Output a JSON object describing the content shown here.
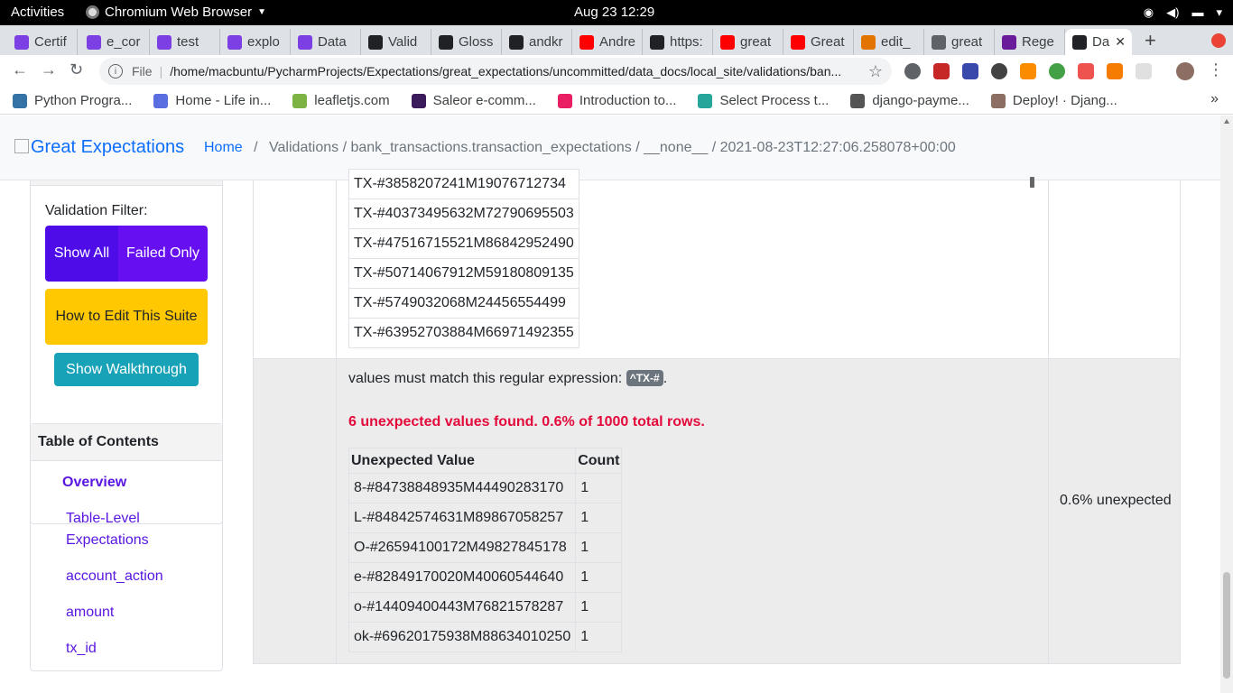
{
  "system_bar": {
    "activities": "Activities",
    "app_name": "Chromium Web Browser",
    "clock": "Aug 23  12:29"
  },
  "tabs": [
    {
      "label": "Certif",
      "icon_color": "#7b3fe4"
    },
    {
      "label": "e_cor",
      "icon_color": "#7b3fe4"
    },
    {
      "label": "test",
      "icon_color": "#7b3fe4"
    },
    {
      "label": "explo",
      "icon_color": "#7b3fe4"
    },
    {
      "label": "Data",
      "icon_color": "#7b3fe4"
    },
    {
      "label": "Valid",
      "icon_color": "#202124"
    },
    {
      "label": "Gloss",
      "icon_color": "#202124"
    },
    {
      "label": "andkr",
      "icon_color": "#202124"
    },
    {
      "label": "Andre",
      "icon_color": "#ff0000"
    },
    {
      "label": "https:",
      "icon_color": "#202124"
    },
    {
      "label": "great",
      "icon_color": "#ff0000"
    },
    {
      "label": "Great",
      "icon_color": "#ff0000"
    },
    {
      "label": "edit_",
      "icon_color": "#e37400"
    },
    {
      "label": "great",
      "icon_color": "#5f6368"
    },
    {
      "label": "Rege",
      "icon_color": "#6a1b9a"
    },
    {
      "label": "Da",
      "icon_color": "#202124"
    }
  ],
  "omnibox": {
    "scheme": "File",
    "url": "/home/macbuntu/PycharmProjects/Expectations/great_expectations/uncommitted/data_docs/local_site/validations/ban..."
  },
  "bookmarks": [
    {
      "label": "Python Progra...",
      "icon_color": "#3572a5"
    },
    {
      "label": "Home - Life in...",
      "icon_color": "#5b6ee1"
    },
    {
      "label": "leafletjs.com",
      "icon_color": "#7cb342"
    },
    {
      "label": "Saleor e-comm...",
      "icon_color": "#3d1a5b"
    },
    {
      "label": "Introduction to...",
      "icon_color": "#e91e63"
    },
    {
      "label": "Select Process t...",
      "icon_color": "#26a69a"
    },
    {
      "label": "django-payme...",
      "icon_color": "#555555"
    },
    {
      "label": "Deploy! · Djang...",
      "icon_color": "#8d6e63"
    }
  ],
  "ge": {
    "logo_alt": "Great Expectations",
    "breadcrumb": {
      "home": "Home",
      "rest": "Validations / bank_transactions.transaction_expectations / __none__ / 2021-08-23T12:27:06.258078+00:00"
    },
    "sidebar": {
      "filter_label": "Validation Filter:",
      "show_all": "Show All",
      "failed_only": "Failed Only",
      "edit_suite": "How to Edit This Suite",
      "walkthrough": "Show Walkthrough"
    },
    "toc": {
      "title": "Table of Contents",
      "items": [
        "Overview",
        "Table-Level Expectations",
        "account_action",
        "amount",
        "tx_id"
      ]
    },
    "upper_values": [
      "TX-#3858207241M19076712734",
      "TX-#40373495632M72790695503",
      "TX-#47516715521M86842952490",
      "TX-#50714067912M59180809135",
      "TX-#5749032068M24456554499",
      "TX-#63952703884M66971492355"
    ],
    "expectation": {
      "text": "values must match this regular expression: ",
      "regex": "^TX-#",
      "after": ".",
      "unexpected_message": "6 unexpected values found. 0.6% of 1000 total rows.",
      "col_value": "Unexpected Value",
      "col_count": "Count",
      "rows": [
        {
          "value": "8-#84738848935M44490283170",
          "count": "1"
        },
        {
          "value": "L-#84842574631M89867058257",
          "count": "1"
        },
        {
          "value": "O-#26594100172M49827845178",
          "count": "1"
        },
        {
          "value": "e-#82849170020M40060544640",
          "count": "1"
        },
        {
          "value": "o-#14409400443M76821578287",
          "count": "1"
        },
        {
          "value": "ok-#69620175938M88634010250",
          "count": "1"
        }
      ],
      "summary": "0.6% unexpected"
    }
  }
}
